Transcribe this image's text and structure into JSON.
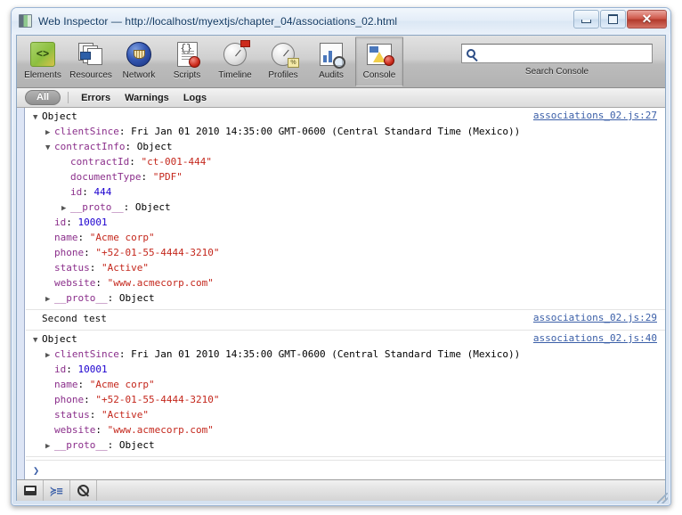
{
  "window": {
    "title": "Web Inspector — http://localhost/myextjs/chapter_04/associations_02.html",
    "app_icon": "inspector-icon",
    "minimize_label": "",
    "maximize_label": "",
    "close_label": "✕"
  },
  "toolbar": {
    "panels": [
      {
        "id": "elements",
        "label": "Elements",
        "icon": "elements-icon",
        "selected": false
      },
      {
        "id": "resources",
        "label": "Resources",
        "icon": "resources-icon",
        "selected": false
      },
      {
        "id": "network",
        "label": "Network",
        "icon": "network-icon",
        "selected": false
      },
      {
        "id": "scripts",
        "label": "Scripts",
        "icon": "scripts-icon",
        "selected": false
      },
      {
        "id": "timeline",
        "label": "Timeline",
        "icon": "timeline-icon",
        "selected": false
      },
      {
        "id": "profiles",
        "label": "Profiles",
        "icon": "profiles-icon",
        "selected": false
      },
      {
        "id": "audits",
        "label": "Audits",
        "icon": "audits-icon",
        "selected": false
      },
      {
        "id": "console",
        "label": "Console",
        "icon": "console-icon",
        "selected": true
      }
    ],
    "search": {
      "value": "",
      "placeholder": "",
      "icon": "search-icon",
      "caption": "Search Console"
    }
  },
  "filterbar": {
    "all": "All",
    "errors": "Errors",
    "warnings": "Warnings",
    "logs": "Logs"
  },
  "console": {
    "messages": [
      {
        "id": "msg-1",
        "source_link": "associations_02.js:27",
        "rows": [
          {
            "indent": 0,
            "disclosure": "open",
            "segments": [
              {
                "kind": "objword",
                "text": "Object"
              }
            ]
          },
          {
            "indent": 1,
            "disclosure": "closed",
            "segments": [
              {
                "kind": "pname",
                "text": "clientSince"
              },
              {
                "kind": "plain",
                "text": ": "
              },
              {
                "kind": "plain",
                "text": "Fri Jan 01 2010 14:35:00 GMT-0600 (Central Standard Time (Mexico))"
              }
            ]
          },
          {
            "indent": 1,
            "disclosure": "open",
            "segments": [
              {
                "kind": "pname",
                "text": "contractInfo"
              },
              {
                "kind": "plain",
                "text": ": "
              },
              {
                "kind": "objword",
                "text": "Object"
              }
            ]
          },
          {
            "indent": 2,
            "disclosure": "none",
            "segments": [
              {
                "kind": "pname",
                "text": "contractId"
              },
              {
                "kind": "plain",
                "text": ": "
              },
              {
                "kind": "sval",
                "text": "\"ct-001-444\""
              }
            ]
          },
          {
            "indent": 2,
            "disclosure": "none",
            "segments": [
              {
                "kind": "pname",
                "text": "documentType"
              },
              {
                "kind": "plain",
                "text": ": "
              },
              {
                "kind": "sval",
                "text": "\"PDF\""
              }
            ]
          },
          {
            "indent": 2,
            "disclosure": "none",
            "segments": [
              {
                "kind": "pname",
                "text": "id"
              },
              {
                "kind": "plain",
                "text": ": "
              },
              {
                "kind": "nval",
                "text": "444"
              }
            ]
          },
          {
            "indent": 2,
            "disclosure": "closed",
            "segments": [
              {
                "kind": "pname",
                "text": "__proto__"
              },
              {
                "kind": "plain",
                "text": ": "
              },
              {
                "kind": "objword",
                "text": "Object"
              }
            ]
          },
          {
            "indent": 1,
            "disclosure": "none",
            "segments": [
              {
                "kind": "pname",
                "text": "id"
              },
              {
                "kind": "plain",
                "text": ": "
              },
              {
                "kind": "nval",
                "text": "10001"
              }
            ]
          },
          {
            "indent": 1,
            "disclosure": "none",
            "segments": [
              {
                "kind": "pname",
                "text": "name"
              },
              {
                "kind": "plain",
                "text": ": "
              },
              {
                "kind": "sval",
                "text": "\"Acme corp\""
              }
            ]
          },
          {
            "indent": 1,
            "disclosure": "none",
            "segments": [
              {
                "kind": "pname",
                "text": "phone"
              },
              {
                "kind": "plain",
                "text": ": "
              },
              {
                "kind": "sval",
                "text": "\"+52-01-55-4444-3210\""
              }
            ]
          },
          {
            "indent": 1,
            "disclosure": "none",
            "segments": [
              {
                "kind": "pname",
                "text": "status"
              },
              {
                "kind": "plain",
                "text": ": "
              },
              {
                "kind": "sval",
                "text": "\"Active\""
              }
            ]
          },
          {
            "indent": 1,
            "disclosure": "none",
            "segments": [
              {
                "kind": "pname",
                "text": "website"
              },
              {
                "kind": "plain",
                "text": ": "
              },
              {
                "kind": "sval",
                "text": "\"www.acmecorp.com\""
              }
            ]
          },
          {
            "indent": 1,
            "disclosure": "closed",
            "segments": [
              {
                "kind": "pname",
                "text": "__proto__"
              },
              {
                "kind": "plain",
                "text": ": "
              },
              {
                "kind": "objword",
                "text": "Object"
              }
            ]
          }
        ]
      },
      {
        "id": "msg-2",
        "source_link": "associations_02.js:29",
        "rows": [
          {
            "indent": 0,
            "disclosure": "none",
            "segments": [
              {
                "kind": "text-msg",
                "text": "Second test"
              }
            ]
          }
        ]
      },
      {
        "id": "msg-3",
        "source_link": "associations_02.js:40",
        "rows": [
          {
            "indent": 0,
            "disclosure": "open",
            "segments": [
              {
                "kind": "objword",
                "text": "Object"
              }
            ]
          },
          {
            "indent": 1,
            "disclosure": "closed",
            "segments": [
              {
                "kind": "pname",
                "text": "clientSince"
              },
              {
                "kind": "plain",
                "text": ": "
              },
              {
                "kind": "plain",
                "text": "Fri Jan 01 2010 14:35:00 GMT-0600 (Central Standard Time (Mexico))"
              }
            ]
          },
          {
            "indent": 1,
            "disclosure": "none",
            "segments": [
              {
                "kind": "pname",
                "text": "id"
              },
              {
                "kind": "plain",
                "text": ": "
              },
              {
                "kind": "nval",
                "text": "10001"
              }
            ]
          },
          {
            "indent": 1,
            "disclosure": "none",
            "segments": [
              {
                "kind": "pname",
                "text": "name"
              },
              {
                "kind": "plain",
                "text": ": "
              },
              {
                "kind": "sval",
                "text": "\"Acme corp\""
              }
            ]
          },
          {
            "indent": 1,
            "disclosure": "none",
            "segments": [
              {
                "kind": "pname",
                "text": "phone"
              },
              {
                "kind": "plain",
                "text": ": "
              },
              {
                "kind": "sval",
                "text": "\"+52-01-55-4444-3210\""
              }
            ]
          },
          {
            "indent": 1,
            "disclosure": "none",
            "segments": [
              {
                "kind": "pname",
                "text": "status"
              },
              {
                "kind": "plain",
                "text": ": "
              },
              {
                "kind": "sval",
                "text": "\"Active\""
              }
            ]
          },
          {
            "indent": 1,
            "disclosure": "none",
            "segments": [
              {
                "kind": "pname",
                "text": "website"
              },
              {
                "kind": "plain",
                "text": ": "
              },
              {
                "kind": "sval",
                "text": "\"www.acmecorp.com\""
              }
            ]
          },
          {
            "indent": 1,
            "disclosure": "closed",
            "segments": [
              {
                "kind": "pname",
                "text": "__proto__"
              },
              {
                "kind": "plain",
                "text": ": "
              },
              {
                "kind": "objword",
                "text": "Object"
              }
            ]
          }
        ]
      }
    ],
    "prompt": {
      "caret": "❯",
      "value": "",
      "placeholder": ""
    }
  },
  "statusbar": {
    "buttons": [
      {
        "id": "dock",
        "icon": "dock-window-icon"
      },
      {
        "id": "show-prompt",
        "icon": "console-prompt-icon",
        "glyph": "≽≡"
      },
      {
        "id": "clear",
        "icon": "clear-console-icon"
      }
    ]
  },
  "colors": {
    "property_name": "#8b2f8b",
    "string_value": "#c4271c",
    "number_value": "#1c00cf",
    "source_link": "#3b5fa8",
    "gutter": "#dde5f5"
  }
}
